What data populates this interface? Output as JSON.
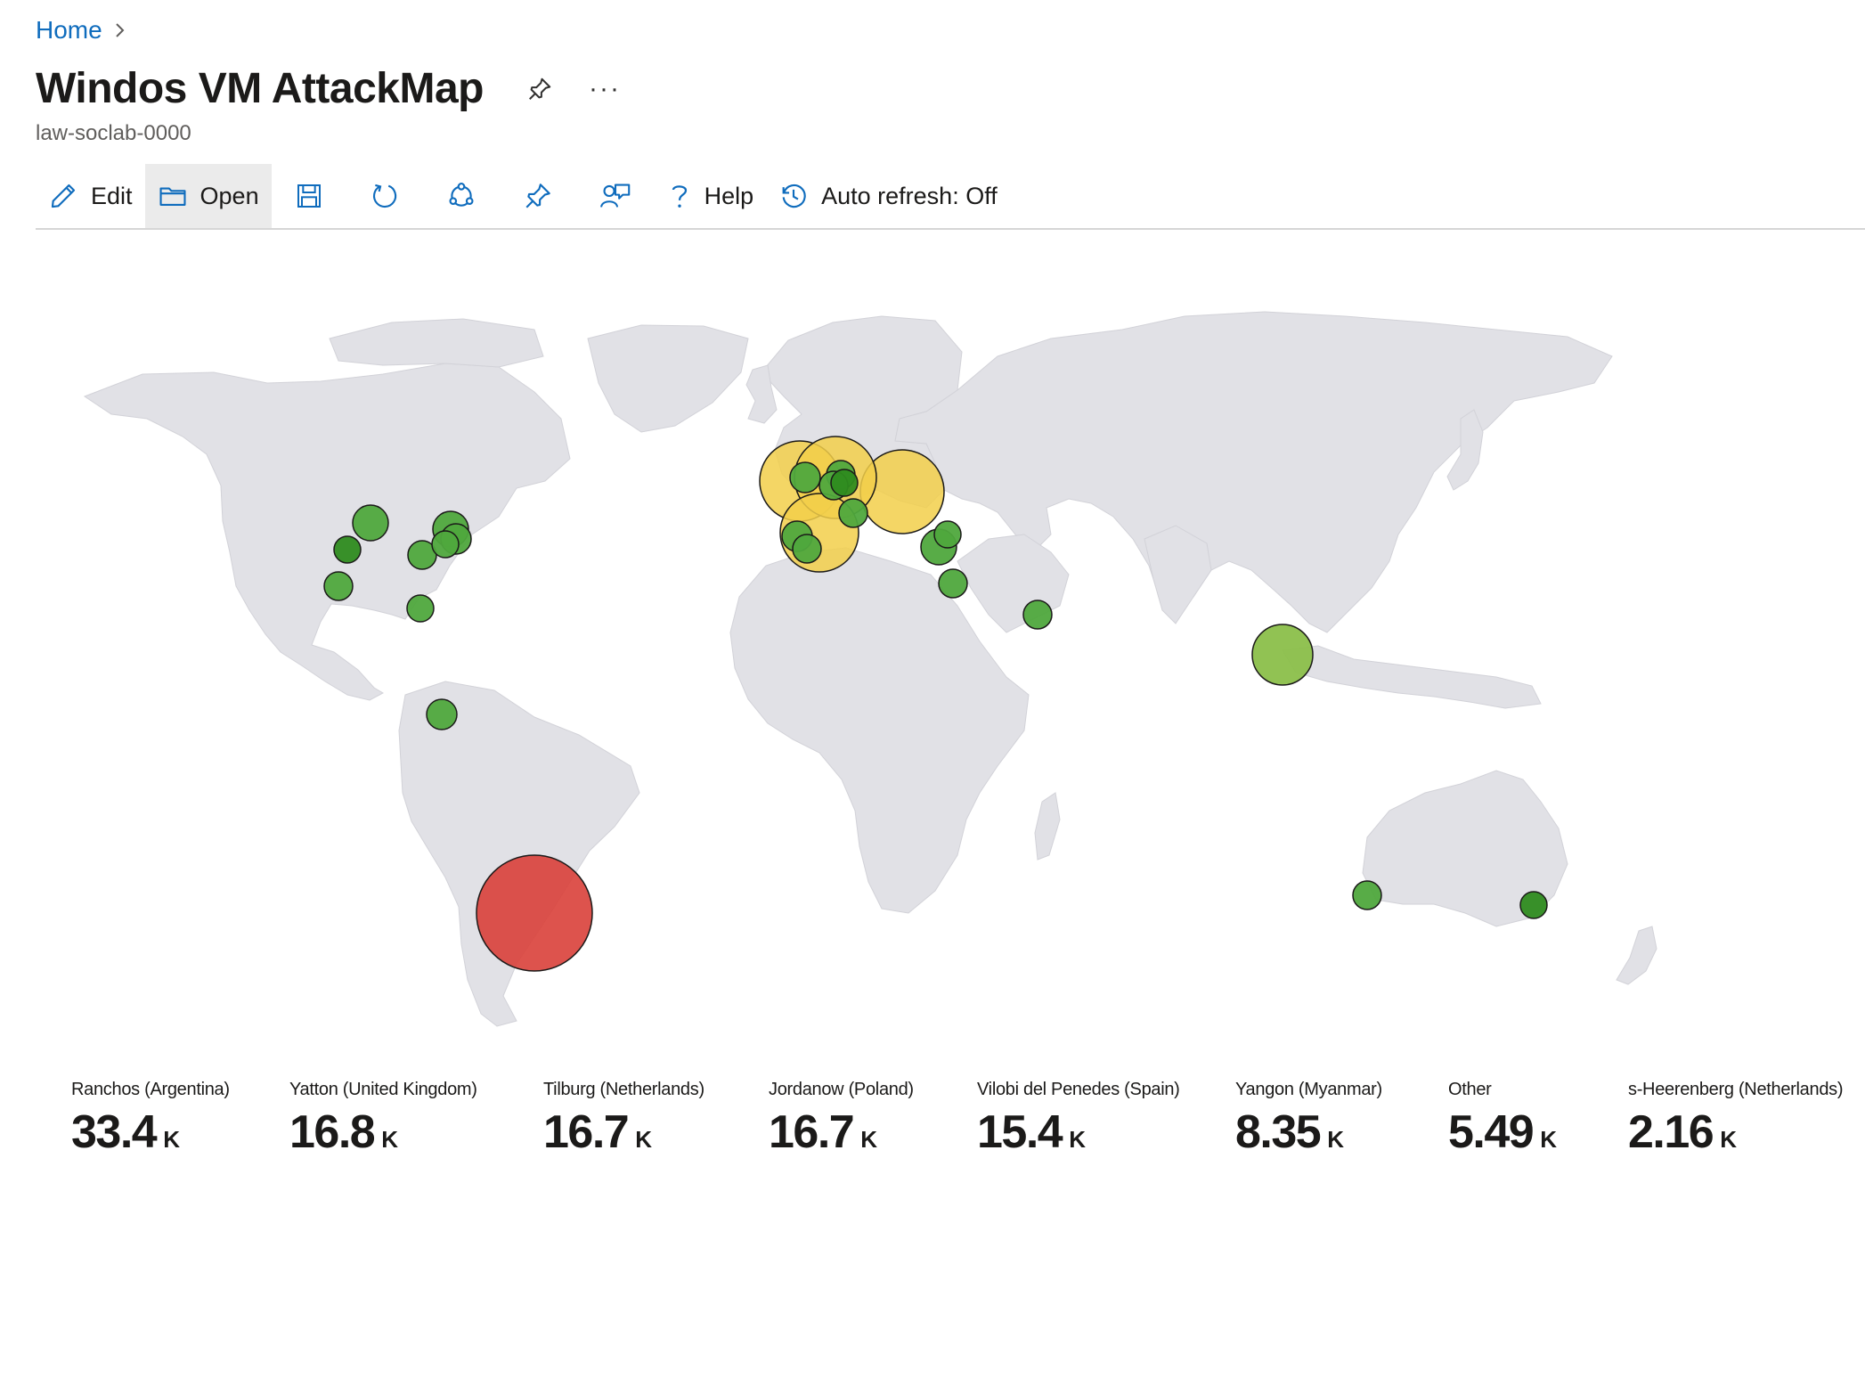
{
  "breadcrumb": {
    "home": "Home"
  },
  "header": {
    "title": "Windos VM AttackMap",
    "subtitle": "law-soclab-0000"
  },
  "toolbar": {
    "edit": "Edit",
    "open": "Open",
    "help": "Help",
    "auto_refresh": "Auto refresh: Off"
  },
  "icons": {
    "edit": "pencil-icon",
    "open": "folder-icon",
    "save": "save-icon",
    "refresh": "refresh-icon",
    "share": "share-icon",
    "pin": "pin-icon",
    "feedback": "feedback-icon",
    "help": "question-icon",
    "history": "clock-icon"
  },
  "colors": {
    "land": "#e1e1e6",
    "bubble_green": "#4fa83d",
    "bubble_dark_green": "#2e8b1f",
    "bubble_light_green": "#8bbf4a",
    "bubble_yellow": "#f2cf4a",
    "bubble_red": "#d9403a",
    "link": "#0f6cbd"
  },
  "stats": [
    {
      "label": "Ranchos (Argentina)",
      "value": "33.4",
      "unit": "K"
    },
    {
      "label": "Yatton (United Kingdom)",
      "value": "16.8",
      "unit": "K"
    },
    {
      "label": "Tilburg (Netherlands)",
      "value": "16.7",
      "unit": "K"
    },
    {
      "label": "Jordanow (Poland)",
      "value": "16.7",
      "unit": "K"
    },
    {
      "label": "Vilobi del Penedes (Spain)",
      "value": "15.4",
      "unit": "K"
    },
    {
      "label": "Yangon (Myanmar)",
      "value": "8.35",
      "unit": "K"
    },
    {
      "label": "Other",
      "value": "5.49",
      "unit": "K"
    },
    {
      "label": "s-Heerenberg (Netherlands)",
      "value": "2.16",
      "unit": "K"
    }
  ]
}
